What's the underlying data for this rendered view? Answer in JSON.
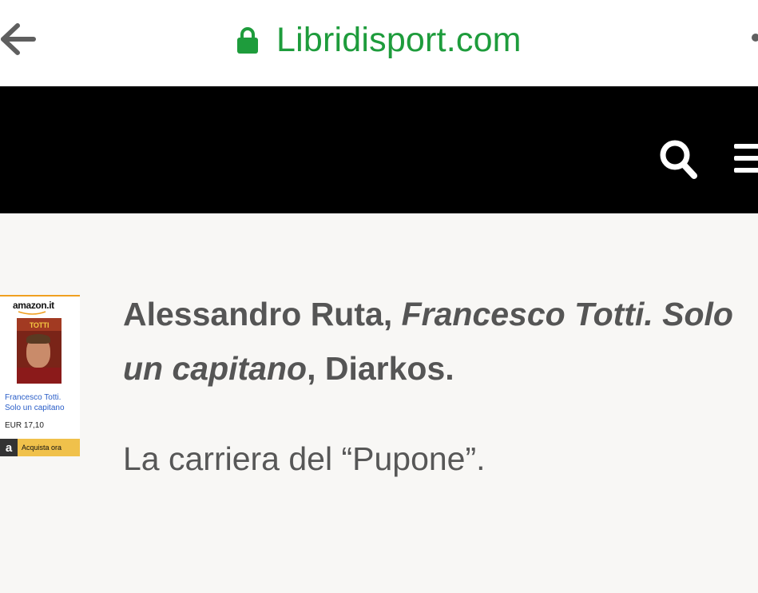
{
  "browser": {
    "url": "Libridisport.com",
    "icons": {
      "back": "arrow-left-icon",
      "lock": "lock-icon",
      "menu": "kebab-icon"
    },
    "url_color": "#1e9c3c"
  },
  "header": {
    "background": "#000000",
    "icons": {
      "search": "search-icon",
      "menu": "hamburger-icon"
    }
  },
  "ad": {
    "brand": "amazon.it",
    "cover_text": "TOTTI",
    "title_line1": "Francesco Totti.",
    "title_line2": "Solo un capitano",
    "price": "EUR 17,10",
    "button_icon": "a",
    "button_label": "Acquista ora"
  },
  "article": {
    "author": "Alessandro Ruta",
    "sep1": ", ",
    "title_part1": "Francesco Totti. Solo",
    "title_part2": "un capitano",
    "sep2": ", ",
    "publisher": "Diarkos.",
    "description": "La carriera del “Pupone”."
  }
}
